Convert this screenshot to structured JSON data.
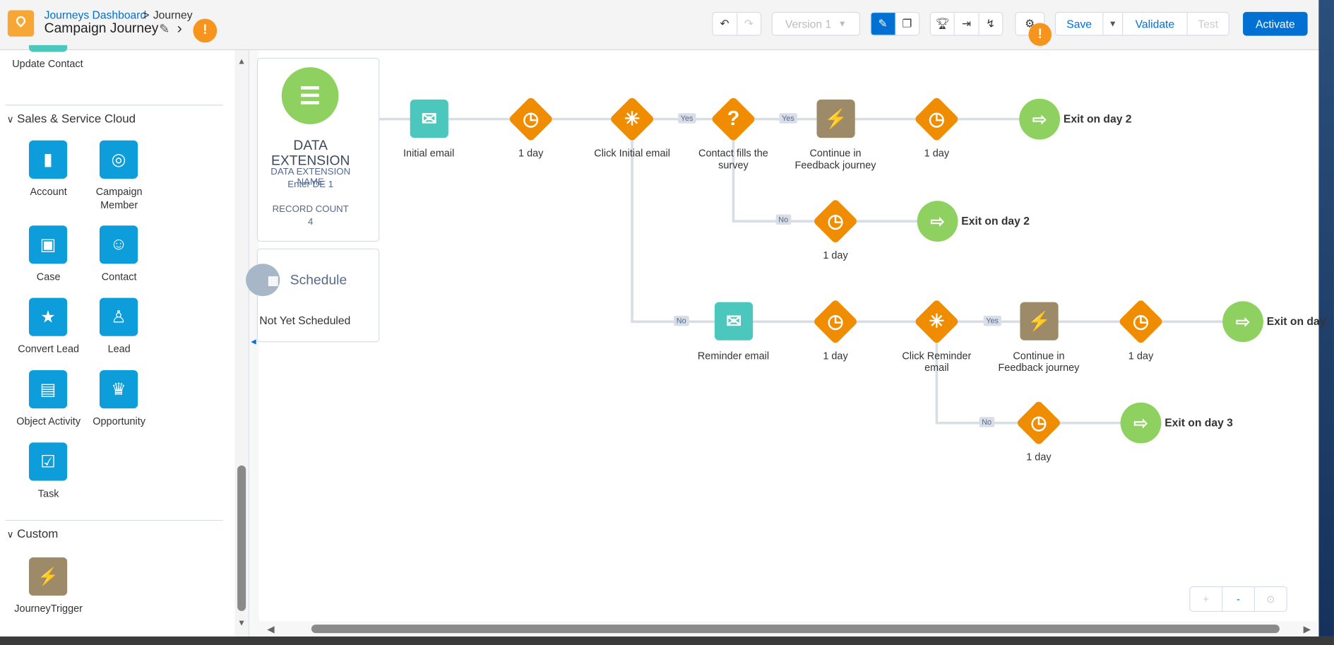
{
  "header": {
    "breadcrumb_parent": "Journeys Dashboard",
    "breadcrumb_sep": ">",
    "breadcrumb_current": "Journey",
    "title": "Campaign Journey"
  },
  "toolbar": {
    "version": "Version 1",
    "save": "Save",
    "validate": "Validate",
    "test": "Test",
    "activate": "Activate"
  },
  "sidebar": {
    "top_item": "Update Contact",
    "sections": [
      {
        "title": "Sales & Service Cloud",
        "items": [
          {
            "label": "Account",
            "icon": "account-icon"
          },
          {
            "label": "Campaign Member",
            "icon": "campaign-member-icon"
          },
          {
            "label": "Case",
            "icon": "case-icon"
          },
          {
            "label": "Contact",
            "icon": "contact-icon"
          },
          {
            "label": "Convert Lead",
            "icon": "convert-lead-icon"
          },
          {
            "label": "Lead",
            "icon": "lead-icon"
          },
          {
            "label": "Object Activity",
            "icon": "object-activity-icon"
          },
          {
            "label": "Opportunity",
            "icon": "opportunity-icon"
          },
          {
            "label": "Task",
            "icon": "task-icon"
          }
        ]
      },
      {
        "title": "Custom",
        "items": [
          {
            "label": "JourneyTrigger",
            "icon": "journey-trigger-icon"
          }
        ]
      }
    ]
  },
  "entry": {
    "de_title": "DATA EXTENSION",
    "de_name_label": "DATA EXTENSION NAME",
    "de_name": "Enter DE 1",
    "record_count_label": "RECORD COUNT",
    "record_count": "4",
    "schedule_title": "Schedule",
    "schedule_status": "Not Yet Scheduled"
  },
  "canvas": {
    "nodes": [
      {
        "type": "email",
        "label": "Initial email"
      },
      {
        "type": "wait",
        "label": "1 day"
      },
      {
        "type": "click",
        "label": "Click Initial email"
      },
      {
        "type": "decision",
        "label": "Contact fills the survey"
      },
      {
        "type": "journey",
        "label": "Continue in Feedback journey"
      },
      {
        "type": "wait",
        "label": "1 day"
      },
      {
        "type": "exit",
        "label": "Exit on day 2"
      },
      {
        "type": "wait",
        "label": "1 day"
      },
      {
        "type": "exit",
        "label": "Exit on day 2"
      },
      {
        "type": "email",
        "label": "Reminder email"
      },
      {
        "type": "wait",
        "label": "1 day"
      },
      {
        "type": "click",
        "label": "Click Reminder email"
      },
      {
        "type": "journey",
        "label": "Continue in Feedback journey"
      },
      {
        "type": "wait",
        "label": "1 day"
      },
      {
        "type": "exit",
        "label": "Exit on day"
      },
      {
        "type": "wait",
        "label": "1 day"
      },
      {
        "type": "exit",
        "label": "Exit on day 3"
      }
    ],
    "branch_labels": [
      "Yes",
      "Yes",
      "No",
      "No",
      "Yes",
      "No"
    ]
  },
  "zoom_controls": {
    "plus": "+",
    "minus": "-",
    "reset": "⊙"
  },
  "colors": {
    "primary": "#0070d2",
    "email": "#4bc7bd",
    "activity": "#f08c00",
    "exit": "#8ed160",
    "journey": "#9c8a68",
    "sidebar_icon": "#0d9dda",
    "entry": "#8ed160"
  }
}
